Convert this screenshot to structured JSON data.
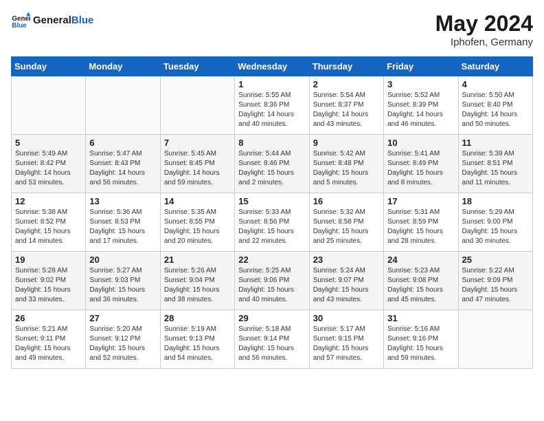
{
  "header": {
    "logo_line1": "General",
    "logo_line2": "Blue",
    "title": "May 2024",
    "subtitle": "Iphofen, Germany"
  },
  "weekdays": [
    "Sunday",
    "Monday",
    "Tuesday",
    "Wednesday",
    "Thursday",
    "Friday",
    "Saturday"
  ],
  "weeks": [
    [
      {
        "day": "",
        "info": ""
      },
      {
        "day": "",
        "info": ""
      },
      {
        "day": "",
        "info": ""
      },
      {
        "day": "1",
        "info": "Sunrise: 5:55 AM\nSunset: 8:36 PM\nDaylight: 14 hours\nand 40 minutes."
      },
      {
        "day": "2",
        "info": "Sunrise: 5:54 AM\nSunset: 8:37 PM\nDaylight: 14 hours\nand 43 minutes."
      },
      {
        "day": "3",
        "info": "Sunrise: 5:52 AM\nSunset: 8:39 PM\nDaylight: 14 hours\nand 46 minutes."
      },
      {
        "day": "4",
        "info": "Sunrise: 5:50 AM\nSunset: 8:40 PM\nDaylight: 14 hours\nand 50 minutes."
      }
    ],
    [
      {
        "day": "5",
        "info": "Sunrise: 5:49 AM\nSunset: 8:42 PM\nDaylight: 14 hours\nand 53 minutes."
      },
      {
        "day": "6",
        "info": "Sunrise: 5:47 AM\nSunset: 8:43 PM\nDaylight: 14 hours\nand 56 minutes."
      },
      {
        "day": "7",
        "info": "Sunrise: 5:45 AM\nSunset: 8:45 PM\nDaylight: 14 hours\nand 59 minutes."
      },
      {
        "day": "8",
        "info": "Sunrise: 5:44 AM\nSunset: 8:46 PM\nDaylight: 15 hours\nand 2 minutes."
      },
      {
        "day": "9",
        "info": "Sunrise: 5:42 AM\nSunset: 8:48 PM\nDaylight: 15 hours\nand 5 minutes."
      },
      {
        "day": "10",
        "info": "Sunrise: 5:41 AM\nSunset: 8:49 PM\nDaylight: 15 hours\nand 8 minutes."
      },
      {
        "day": "11",
        "info": "Sunrise: 5:39 AM\nSunset: 8:51 PM\nDaylight: 15 hours\nand 11 minutes."
      }
    ],
    [
      {
        "day": "12",
        "info": "Sunrise: 5:38 AM\nSunset: 8:52 PM\nDaylight: 15 hours\nand 14 minutes."
      },
      {
        "day": "13",
        "info": "Sunrise: 5:36 AM\nSunset: 8:53 PM\nDaylight: 15 hours\nand 17 minutes."
      },
      {
        "day": "14",
        "info": "Sunrise: 5:35 AM\nSunset: 8:55 PM\nDaylight: 15 hours\nand 20 minutes."
      },
      {
        "day": "15",
        "info": "Sunrise: 5:33 AM\nSunset: 8:56 PM\nDaylight: 15 hours\nand 22 minutes."
      },
      {
        "day": "16",
        "info": "Sunrise: 5:32 AM\nSunset: 8:58 PM\nDaylight: 15 hours\nand 25 minutes."
      },
      {
        "day": "17",
        "info": "Sunrise: 5:31 AM\nSunset: 8:59 PM\nDaylight: 15 hours\nand 28 minutes."
      },
      {
        "day": "18",
        "info": "Sunrise: 5:29 AM\nSunset: 9:00 PM\nDaylight: 15 hours\nand 30 minutes."
      }
    ],
    [
      {
        "day": "19",
        "info": "Sunrise: 5:28 AM\nSunset: 9:02 PM\nDaylight: 15 hours\nand 33 minutes."
      },
      {
        "day": "20",
        "info": "Sunrise: 5:27 AM\nSunset: 9:03 PM\nDaylight: 15 hours\nand 36 minutes."
      },
      {
        "day": "21",
        "info": "Sunrise: 5:26 AM\nSunset: 9:04 PM\nDaylight: 15 hours\nand 38 minutes."
      },
      {
        "day": "22",
        "info": "Sunrise: 5:25 AM\nSunset: 9:06 PM\nDaylight: 15 hours\nand 40 minutes."
      },
      {
        "day": "23",
        "info": "Sunrise: 5:24 AM\nSunset: 9:07 PM\nDaylight: 15 hours\nand 43 minutes."
      },
      {
        "day": "24",
        "info": "Sunrise: 5:23 AM\nSunset: 9:08 PM\nDaylight: 15 hours\nand 45 minutes."
      },
      {
        "day": "25",
        "info": "Sunrise: 5:22 AM\nSunset: 9:09 PM\nDaylight: 15 hours\nand 47 minutes."
      }
    ],
    [
      {
        "day": "26",
        "info": "Sunrise: 5:21 AM\nSunset: 9:11 PM\nDaylight: 15 hours\nand 49 minutes."
      },
      {
        "day": "27",
        "info": "Sunrise: 5:20 AM\nSunset: 9:12 PM\nDaylight: 15 hours\nand 52 minutes."
      },
      {
        "day": "28",
        "info": "Sunrise: 5:19 AM\nSunset: 9:13 PM\nDaylight: 15 hours\nand 54 minutes."
      },
      {
        "day": "29",
        "info": "Sunrise: 5:18 AM\nSunset: 9:14 PM\nDaylight: 15 hours\nand 56 minutes."
      },
      {
        "day": "30",
        "info": "Sunrise: 5:17 AM\nSunset: 9:15 PM\nDaylight: 15 hours\nand 57 minutes."
      },
      {
        "day": "31",
        "info": "Sunrise: 5:16 AM\nSunset: 9:16 PM\nDaylight: 15 hours\nand 59 minutes."
      },
      {
        "day": "",
        "info": ""
      }
    ]
  ]
}
